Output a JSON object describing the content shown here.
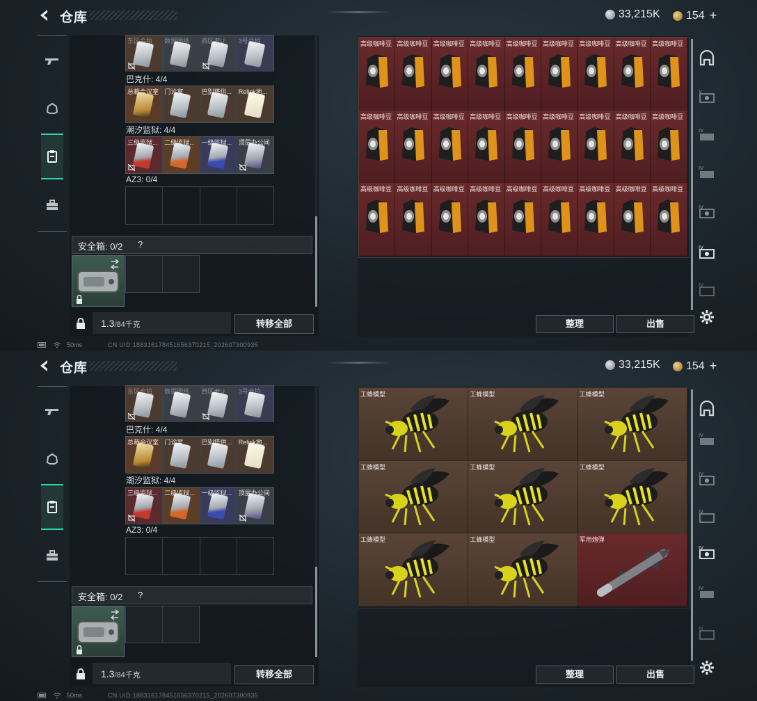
{
  "screens": [
    {
      "title": "仓库",
      "currency": {
        "silver": "33,215K",
        "gold": "154"
      },
      "left": {
        "row0_labels": [
          "东区会拍",
          "数据图纸",
          "西区者U",
          "3号会拍"
        ],
        "group1": "巴克什: 4/4",
        "row1_labels": [
          "总裁会议室",
          "门诊室",
          "巴别塔供...",
          "Relink地..."
        ],
        "group2": "潮汐监狱: 4/4",
        "row2_labels": [
          "三级监狱...",
          "二级监狱...",
          "一级监狱...",
          "顶层办公间"
        ],
        "group3": "AZ3: 0/4",
        "safebox": "安全箱: 0/2",
        "safebox_q": "?",
        "weight": "1.3",
        "weight_max": "/84千克",
        "transfer": "转移全部"
      },
      "right_type": "coffee",
      "item_label": "高级咖啡豆",
      "sort": "整理",
      "sell": "出售",
      "status_ping": "50ms",
      "uid": "CN UID:18831617845165637021​5_202607300935"
    },
    {
      "title": "仓库",
      "currency": {
        "silver": "33,215K",
        "gold": "154"
      },
      "left": {
        "row0_labels": [
          "东区会拍",
          "数据图纸",
          "西区者U",
          "3号会拍"
        ],
        "group1": "巴克什: 4/4",
        "row1_labels": [
          "总裁会议室",
          "门诊室",
          "巴别塔供...",
          "Relink地..."
        ],
        "group2": "潮汐监狱: 4/4",
        "row2_labels": [
          "三级监狱...",
          "二级监狱...",
          "一级监狱...",
          "顶层办公间"
        ],
        "group3": "AZ3: 0/4",
        "safebox": "安全箱: 0/2",
        "safebox_q": "?",
        "weight": "1.3",
        "weight_max": "/84千克",
        "transfer": "转移全部"
      },
      "right_type": "bees",
      "bee_label": "工蜂模型",
      "missile_label": "军用炮弹",
      "sort": "整理",
      "sell": "出售",
      "status_ping": "50ms",
      "uid": "CN UID:18831617845165637021​5_202607300935"
    }
  ]
}
